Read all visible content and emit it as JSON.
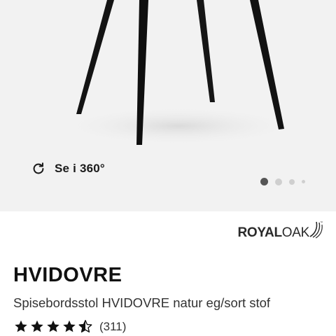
{
  "gallery": {
    "view360_label": "Se i 360°",
    "active_slide": 1,
    "slide_count": 4,
    "background": "#f2f2f2"
  },
  "product": {
    "brand": {
      "part1": "ROYAL",
      "part2": "OAK",
      "trademark": "™"
    },
    "title": "HVIDOVRE",
    "subtitle": "Spisebordsstol HVIDOVRE natur eg/sort stof",
    "rating": {
      "value": 4.5,
      "max": 5,
      "count_label": "(311)"
    }
  },
  "icons": {
    "rotate": "rotate-360-icon",
    "star_full": "star-filled-icon",
    "star_half": "star-half-icon"
  }
}
